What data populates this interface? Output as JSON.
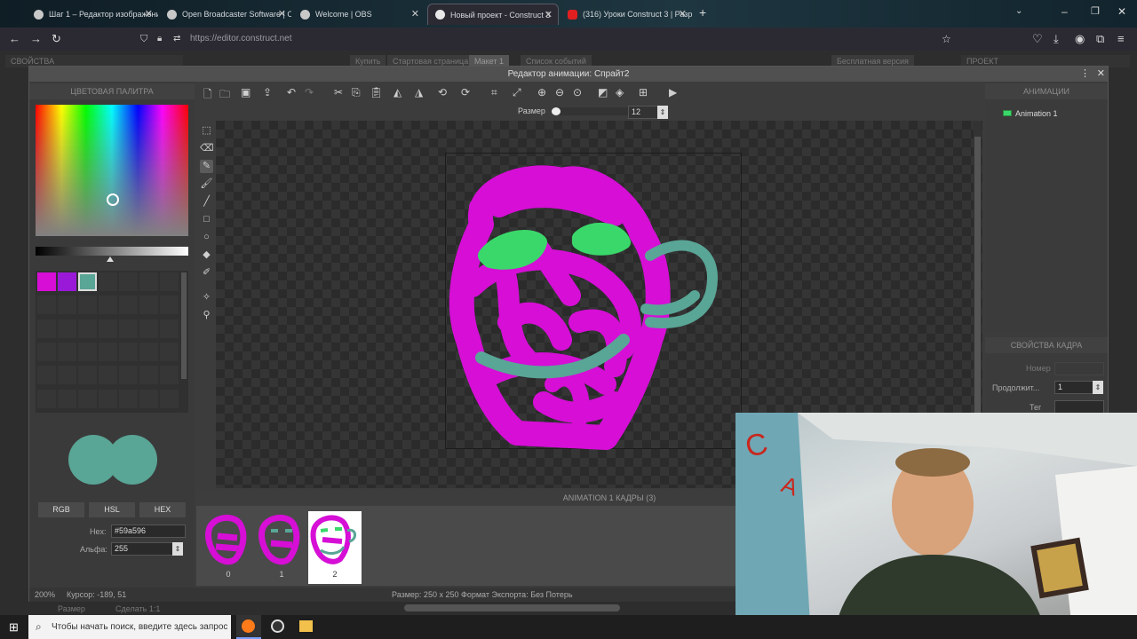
{
  "tabs": [
    {
      "label": "Шаг 1 – Редактор изображени",
      "active": false
    },
    {
      "label": "Open Broadcaster Software | O",
      "active": false
    },
    {
      "label": "Welcome | OBS",
      "active": false
    },
    {
      "label": "Новый проект - Construct 3",
      "active": true
    },
    {
      "label": "(316) Уроки Construct 3 | Разр",
      "active": false
    }
  ],
  "address": {
    "url": "https://editor.construct.net"
  },
  "background_tabs": [
    "СВОЙСТВА",
    "Купить",
    "Стартовая страница",
    "Макет 1",
    "Список событий",
    "Бесплатная версия",
    "ПРОЕКТ",
    "Сделать 1:1",
    "Размер"
  ],
  "editor": {
    "title": "Редактор анимации: Спрайт2",
    "palette": {
      "title": "ЦВЕТОВАЯ ПАЛИТРА",
      "swatch_colors": [
        "#d60ed6",
        "#9a19d8",
        "#59a596"
      ],
      "modes": [
        "RGB",
        "HSL",
        "HEX"
      ],
      "hex_label": "Hex:",
      "hex_value": "#59a596",
      "alpha_label": "Альфа:",
      "alpha_value": "255",
      "primary_color": "#59a596",
      "secondary_color": "#59a596"
    },
    "size": {
      "label": "Размер",
      "value": "12"
    },
    "animations": {
      "title": "АНИМАЦИИ",
      "items": [
        "Animation 1"
      ]
    },
    "frame_props": {
      "title": "СВОЙСТВА КАДРА",
      "number_label": "Номер",
      "duration_label": "Продолжит...",
      "duration_value": "1",
      "tag_label": "Тег"
    },
    "frames": {
      "title": "ANIMATION 1 КАДРЫ (3)",
      "items": [
        "0",
        "1",
        "2"
      ]
    },
    "status": {
      "zoom": "200%",
      "cursor": "Курсор: -189, 51",
      "size": "Размер: 250 x 250",
      "format": "Формат Экспорта: Без Потерь"
    }
  },
  "taskbar": {
    "search_placeholder": "Чтобы начать поиск, введите здесь запрос"
  },
  "colors": {
    "magenta": "#d60ed6",
    "green": "#3ad86a",
    "teal": "#59a596"
  }
}
